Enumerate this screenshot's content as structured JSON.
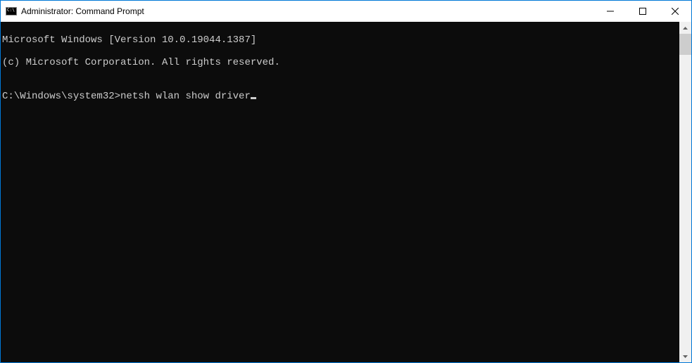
{
  "window": {
    "title": "Administrator: Command Prompt"
  },
  "terminal": {
    "line1": "Microsoft Windows [Version 10.0.19044.1387]",
    "line2": "(c) Microsoft Corporation. All rights reserved.",
    "blank": "",
    "prompt": "C:\\Windows\\system32>",
    "command": "netsh wlan show driver"
  }
}
